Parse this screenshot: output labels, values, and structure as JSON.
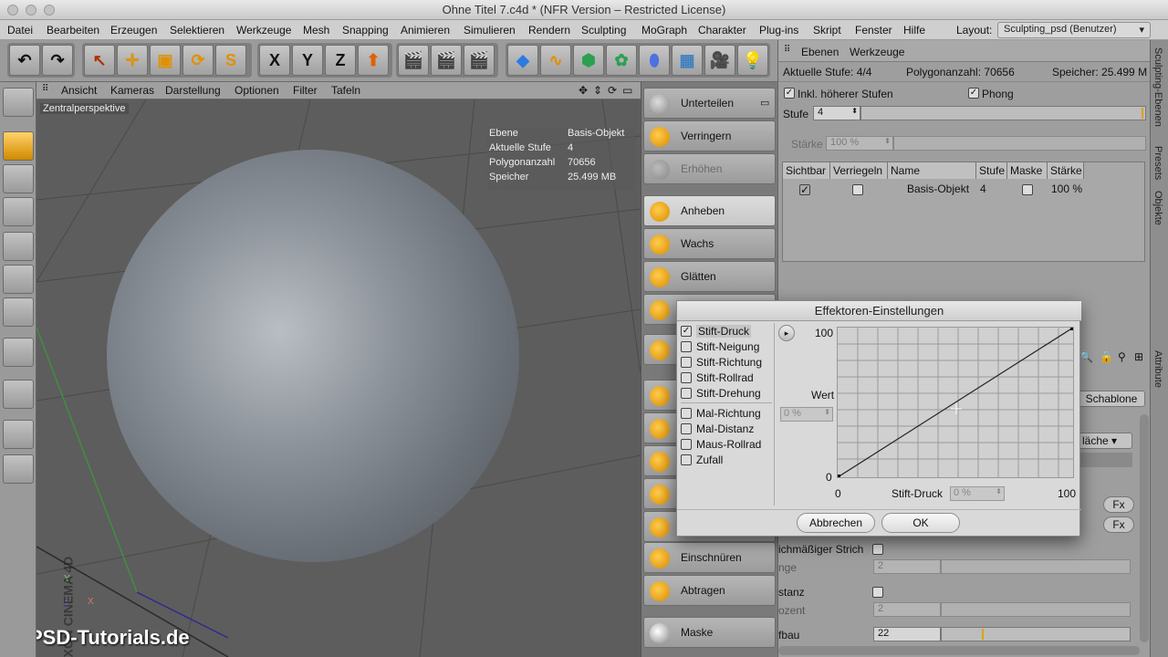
{
  "window": {
    "title": "Ohne Titel 7.c4d * (NFR Version – Restricted License)"
  },
  "menubar": {
    "items": [
      "Datei",
      "Bearbeiten",
      "Erzeugen",
      "Selektieren",
      "Werkzeuge",
      "Mesh",
      "Snapping",
      "Animieren",
      "Simulieren",
      "Rendern",
      "Sculpting",
      "MoGraph",
      "Charakter",
      "Plug-ins",
      "Skript",
      "Fenster",
      "Hilfe"
    ],
    "layout_label": "Layout:",
    "layout_value": "Sculpting_psd (Benutzer)"
  },
  "toolbar": {
    "x_label": "X",
    "y_label": "Y",
    "z_label": "Z"
  },
  "viewport": {
    "menu": [
      "Ansicht",
      "Kameras",
      "Darstellung",
      "Optionen",
      "Filter",
      "Tafeln"
    ],
    "label": "Zentralperspektive",
    "hud": [
      {
        "key": "Ebene",
        "value": "Basis-Objekt"
      },
      {
        "key": "Aktuelle Stufe",
        "value": "4"
      },
      {
        "key": "Polygonanzahl",
        "value": "70656"
      },
      {
        "key": "Speicher",
        "value": "25.499 MB"
      }
    ],
    "brand": "MAXON CINEMA 4D",
    "watermark": "PSD-Tutorials.de"
  },
  "sculpt_tools": [
    "Unterteilen",
    "Verringern",
    "Erhöhen",
    "Anheben",
    "Wachs",
    "Glätten",
    "Einschnüren",
    "Abtragen",
    "Maske"
  ],
  "layers": {
    "tabs": [
      "Ebenen",
      "Werkzeuge"
    ],
    "info": {
      "aktuelle_stufe": "Aktuelle Stufe: 4/4",
      "polygonanzahl": "Polygonanzahl: 70656",
      "speicher": "Speicher: 25.499 M"
    },
    "inkl_label": "Inkl. höherer Stufen",
    "phong_label": "Phong",
    "stufe_label": "Stufe",
    "stufe_value": "4",
    "staerke_label": "Stärke",
    "staerke_value": "100 %",
    "columns": [
      "Sichtbar",
      "Verriegeln",
      "Name",
      "Stufe",
      "Maske",
      "Stärke"
    ],
    "row": {
      "name": "Basis-Objekt",
      "stufe": "4",
      "staerke": "100 %"
    }
  },
  "attributes": {
    "schablone": "Schablone",
    "flaeche": "läche",
    "fx": "Fx",
    "strich": "ichmäßiger Strich",
    "nge": "nge",
    "two": "2",
    "stanz": "stanz",
    "ozent": "ozent",
    "fbau": "fbau",
    "fbau_value": "22"
  },
  "right_tabs": [
    "Sculpting-Ebenen",
    "Presets",
    "Objekte",
    "Attribute"
  ],
  "dialog": {
    "title": "Effektoren-Einstellungen",
    "options": [
      {
        "label": "Stift-Druck",
        "checked": true
      },
      {
        "label": "Stift-Neigung",
        "checked": false
      },
      {
        "label": "Stift-Richtung",
        "checked": false
      },
      {
        "label": "Stift-Rollrad",
        "checked": false
      },
      {
        "label": "Stift-Drehung",
        "checked": false
      },
      {
        "label": "Mal-Richtung",
        "checked": false
      },
      {
        "label": "Mal-Distanz",
        "checked": false
      },
      {
        "label": "Maus-Rollrad",
        "checked": false
      },
      {
        "label": "Zufall",
        "checked": false
      }
    ],
    "wert_label": "Wert",
    "wert_value": "0 %",
    "x_label": "Stift-Druck",
    "x_value": "0 %",
    "y_max": "100",
    "y_min": "0",
    "x_min": "0",
    "x_max": "100",
    "cancel": "Abbrechen",
    "ok": "OK"
  }
}
